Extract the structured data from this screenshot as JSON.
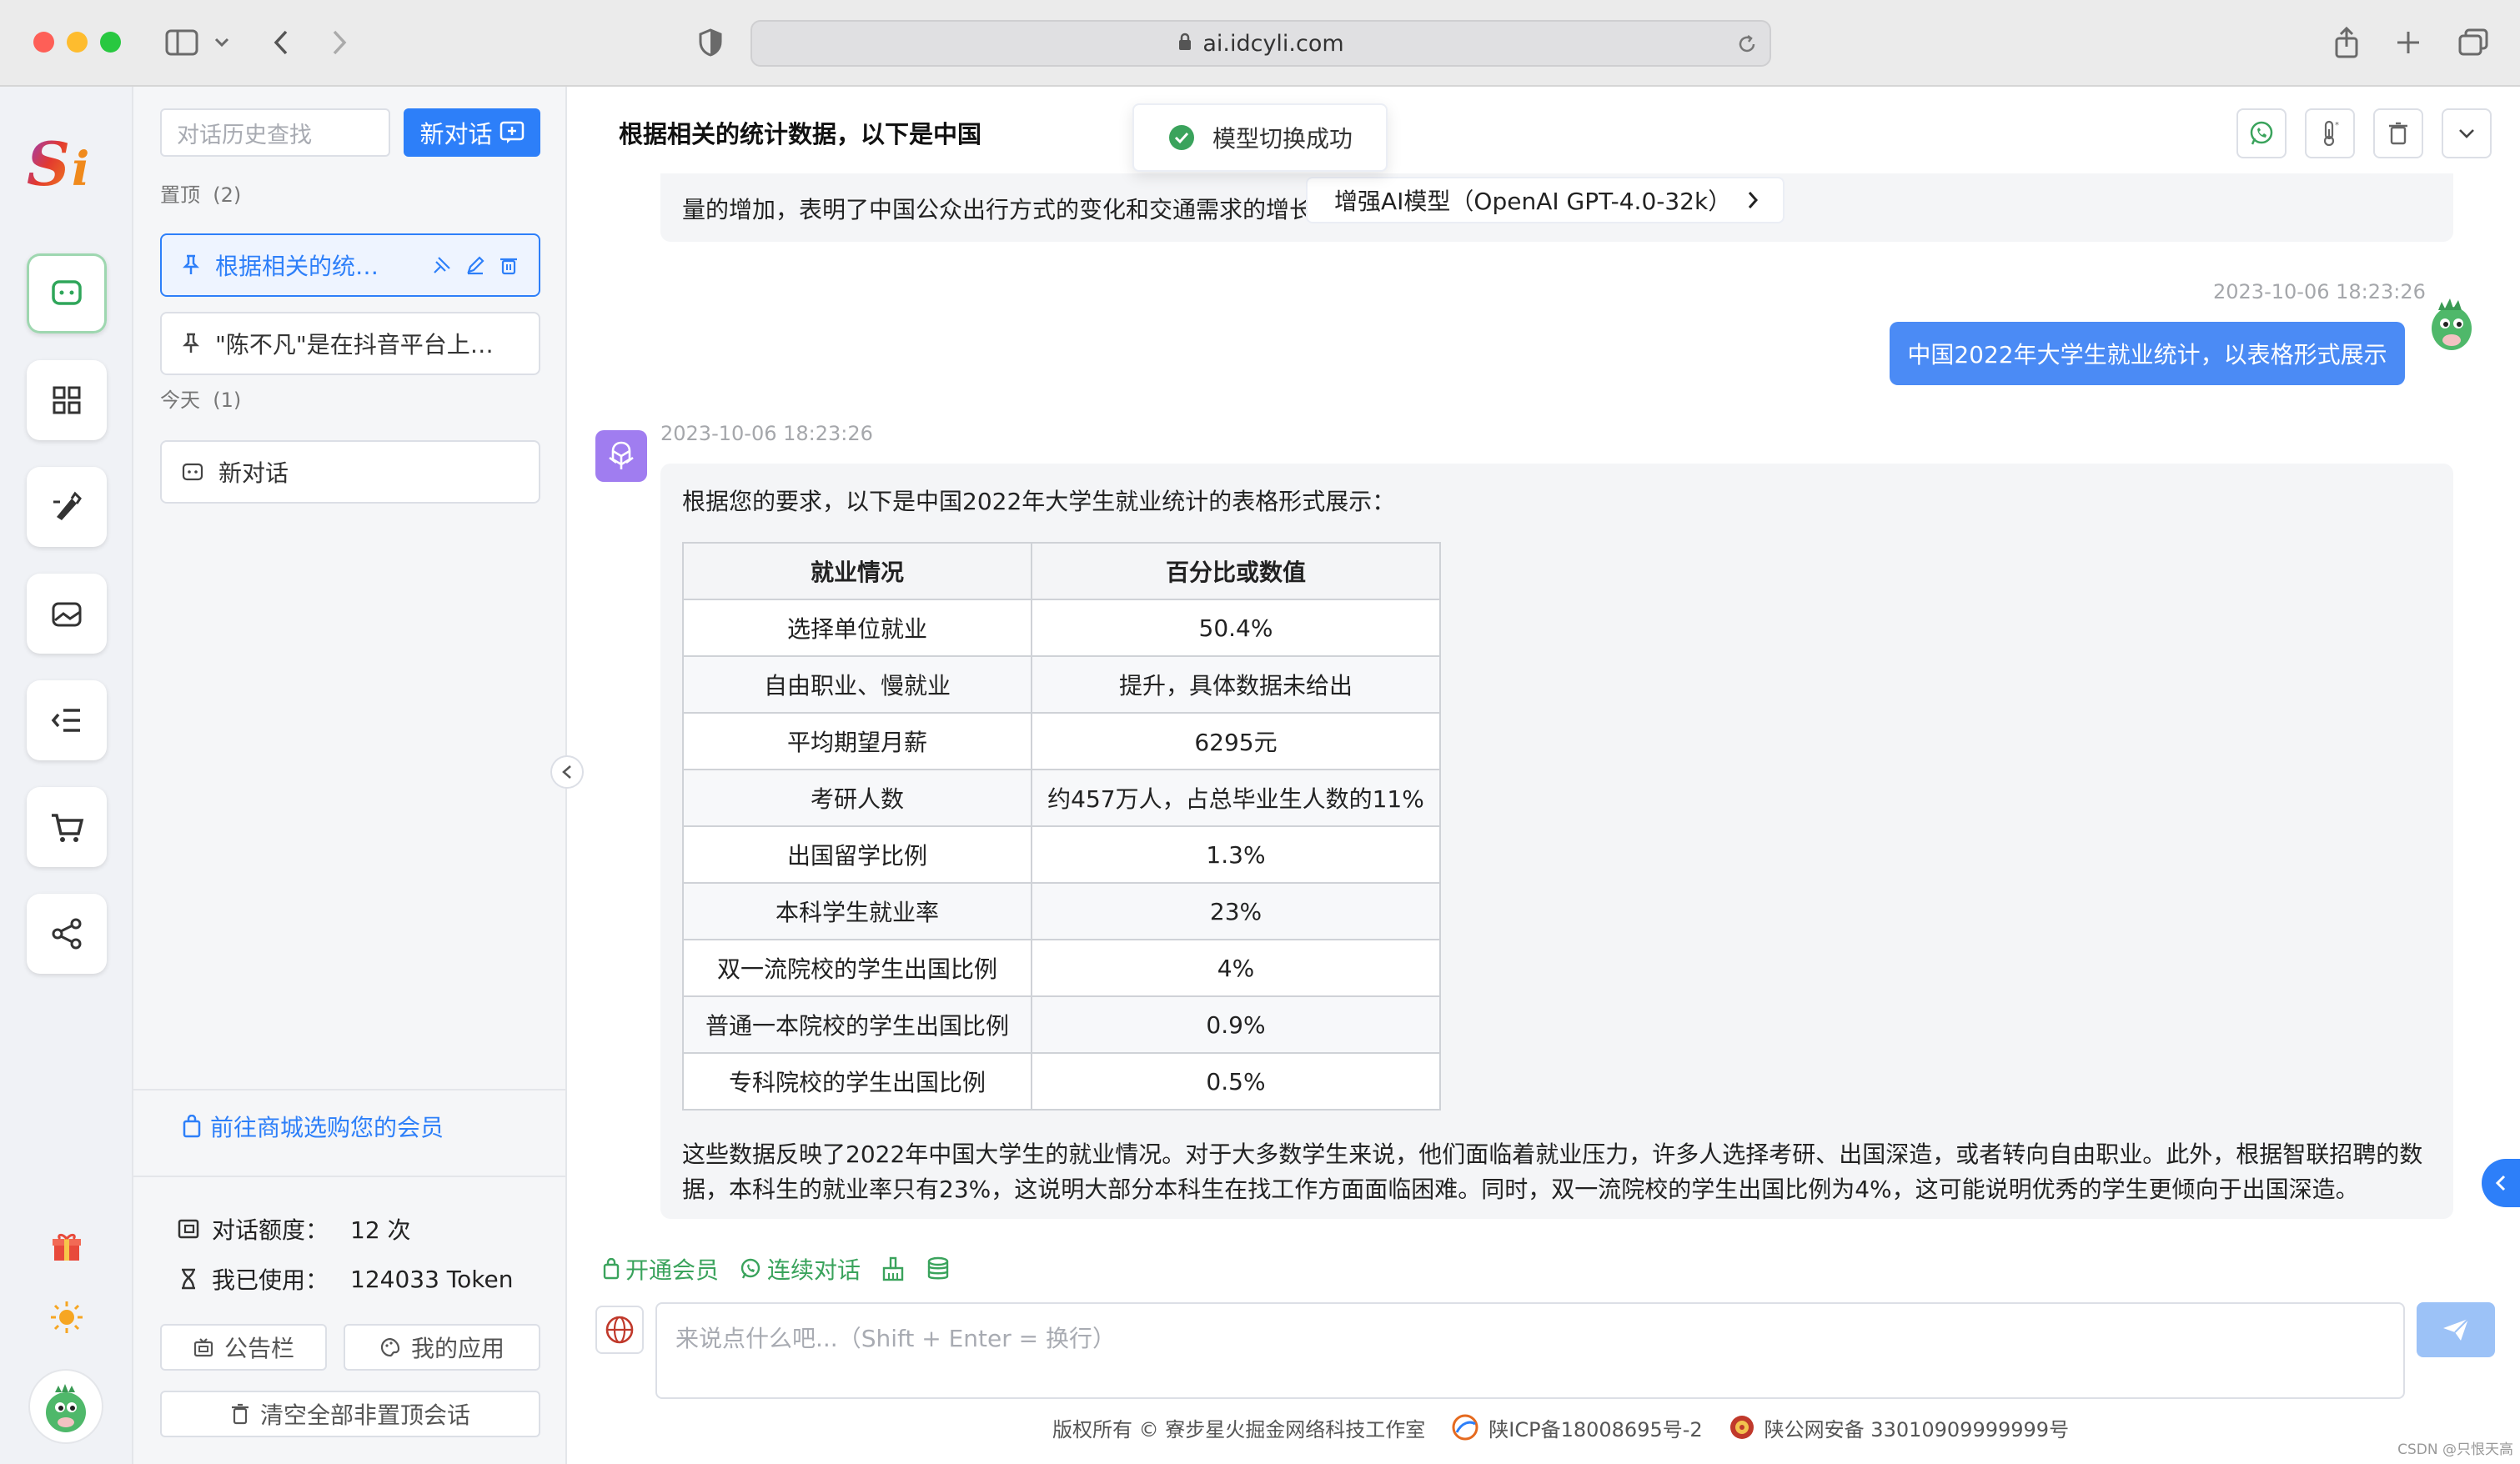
{
  "browser": {
    "url": "ai.idcyli.com"
  },
  "app": {
    "logo_text": "Si",
    "brand_colors": [
      "#e33a2f",
      "#f08a1c",
      "#8a3fd9"
    ]
  },
  "sidebar": {
    "search_placeholder": "对话历史查找",
    "new_chat_label": "新对话",
    "pinned_label": "置顶",
    "pinned_count": "(2)",
    "pinned": [
      {
        "title": "根据相关的统…"
      },
      {
        "title": "\"陈不凡\"是在抖音平台上…"
      }
    ],
    "today_label": "今天",
    "today_count": "(1)",
    "today": [
      {
        "title": "新对话"
      }
    ],
    "shop_link": "前往商城选购您的会员",
    "quota_label": "对话额度：",
    "quota_value": "12 次",
    "used_label": "我已使用：",
    "used_value": "124033 Token",
    "notice_btn": "公告栏",
    "myapps_btn": "我的应用",
    "clear_btn": "清空全部非置顶会话"
  },
  "chat": {
    "title": "根据相关的统计数据，以下是中国",
    "toast": "模型切换成功",
    "model_chip": "增强AI模型（OpenAI GPT-4.0-32k）",
    "prev_text": "量的增加，表明了中国公众出行方式的变化和交通需求的增长",
    "user_time": "2023-10-06 18:23:26",
    "user_msg": "中国2022年大学生就业统计，以表格形式展示",
    "ai_time": "2023-10-06 18:23:26",
    "ai_intro": "根据您的要求，以下是中国2022年大学生就业统计的表格形式展示：",
    "table_headers": [
      "就业情况",
      "百分比或数值"
    ],
    "table_rows": [
      [
        "选择单位就业",
        "50.4%"
      ],
      [
        "自由职业、慢就业",
        "提升，具体数据未给出"
      ],
      [
        "平均期望月薪",
        "6295元"
      ],
      [
        "考研人数",
        "约457万人，占总毕业生人数的11%"
      ],
      [
        "出国留学比例",
        "1.3%"
      ],
      [
        "本科学生就业率",
        "23%"
      ],
      [
        "双一流院校的学生出国比例",
        "4%"
      ],
      [
        "普通一本院校的学生出国比例",
        "0.9%"
      ],
      [
        "专科院校的学生出国比例",
        "0.5%"
      ]
    ],
    "ai_paragraph": "这些数据反映了2022年中国大学生的就业情况。对于大多数学生来说，他们面临着就业压力，许多人选择考研、出国深造，或者转向自由职业。此外，根据智联招聘的数据，本科生的就业率只有23%，这说明大部分本科生在找工作方面面临困难。同时，双一流院校的学生出国比例为4%，这可能说明优秀的学生更倾向于出国深造。",
    "action_member": "开通会员",
    "action_continuous": "连续对话",
    "input_placeholder": "来说点什么吧...（Shift + Enter = 换行）"
  },
  "footer": {
    "copyright": "版权所有 © 寮步星火掘金网络科技工作室",
    "icp": "陕ICP备18008695号-2",
    "police": "陕公网安备 33010909999999号"
  },
  "watermark": "CSDN @只恨天高",
  "colors": {
    "accent": "#2d7ff9",
    "user_bubble": "#4b8bf5",
    "success": "#3aa35c"
  }
}
